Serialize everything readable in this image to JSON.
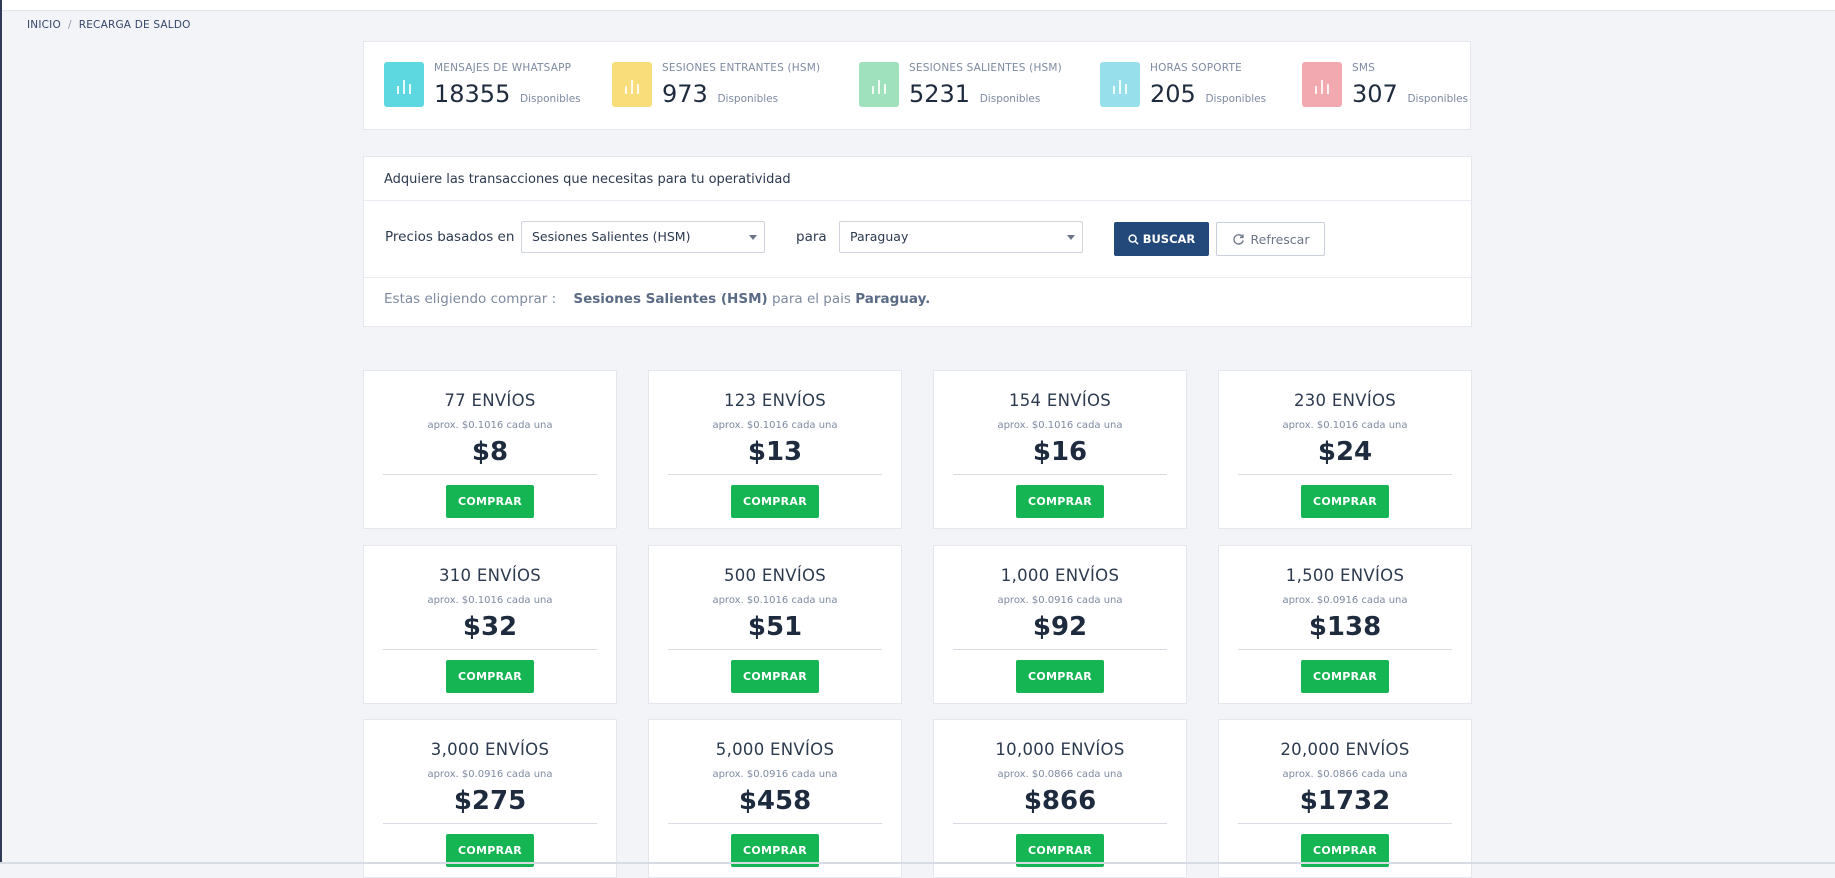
{
  "breadcrumb": {
    "home": "INICIO",
    "separator": "/",
    "current": "RECARGA DE SALDO"
  },
  "stats": [
    {
      "label": "MENSAJES DE WHATSAPP",
      "value": "18355",
      "suffix": "Disponibles",
      "color": "#5dd8e0",
      "icon": "bar-chart-icon"
    },
    {
      "label": "SESIONES ENTRANTES (HSM)",
      "value": "973",
      "suffix": "Disponibles",
      "color": "#f9dd7a",
      "icon": "bar-chart-icon"
    },
    {
      "label": "SESIONES SALIENTES (HSM)",
      "value": "5231",
      "suffix": "Disponibles",
      "color": "#9fe0bd",
      "icon": "bar-chart-icon"
    },
    {
      "label": "HORAS SOPORTE",
      "value": "205",
      "suffix": "Disponibles",
      "color": "#97e0eb",
      "icon": "bar-chart-icon"
    },
    {
      "label": "SMS",
      "value": "307",
      "suffix": "Disponibles",
      "color": "#f2aab0",
      "icon": "bar-chart-icon"
    }
  ],
  "panel": {
    "title": "Adquiere las transacciones que necesitas para tu operatividad",
    "price_label": "Precios basados en",
    "price_select": "Sesiones Salientes (HSM)",
    "for_label": "para",
    "country_select": "Paraguay",
    "search_button": "BUSCAR",
    "refresh_button": "Refrescar",
    "choice_prefix": "Estas eligiendo comprar :",
    "choice_product": "Sesiones Salientes (HSM)",
    "choice_middle": "para el pais",
    "choice_country": "Paraguay",
    "choice_end": "."
  },
  "packages": [
    {
      "qty": "77 ENVÍOS",
      "each": "aprox. $0.1016 cada una",
      "price": "$8",
      "button": "COMPRAR"
    },
    {
      "qty": "123 ENVÍOS",
      "each": "aprox. $0.1016 cada una",
      "price": "$13",
      "button": "COMPRAR"
    },
    {
      "qty": "154 ENVÍOS",
      "each": "aprox. $0.1016 cada una",
      "price": "$16",
      "button": "COMPRAR"
    },
    {
      "qty": "230 ENVÍOS",
      "each": "aprox. $0.1016 cada una",
      "price": "$24",
      "button": "COMPRAR"
    },
    {
      "qty": "310 ENVÍOS",
      "each": "aprox. $0.1016 cada una",
      "price": "$32",
      "button": "COMPRAR"
    },
    {
      "qty": "500 ENVÍOS",
      "each": "aprox. $0.1016 cada una",
      "price": "$51",
      "button": "COMPRAR"
    },
    {
      "qty": "1,000 ENVÍOS",
      "each": "aprox. $0.0916 cada una",
      "price": "$92",
      "button": "COMPRAR"
    },
    {
      "qty": "1,500 ENVÍOS",
      "each": "aprox. $0.0916 cada una",
      "price": "$138",
      "button": "COMPRAR"
    },
    {
      "qty": "3,000 ENVÍOS",
      "each": "aprox. $0.0916 cada una",
      "price": "$275",
      "button": "COMPRAR"
    },
    {
      "qty": "5,000 ENVÍOS",
      "each": "aprox. $0.0916 cada una",
      "price": "$458",
      "button": "COMPRAR"
    },
    {
      "qty": "10,000 ENVÍOS",
      "each": "aprox. $0.0866 cada una",
      "price": "$866",
      "button": "COMPRAR"
    },
    {
      "qty": "20,000 ENVÍOS",
      "each": "aprox. $0.0866 cada una",
      "price": "$1732",
      "button": "COMPRAR"
    }
  ]
}
